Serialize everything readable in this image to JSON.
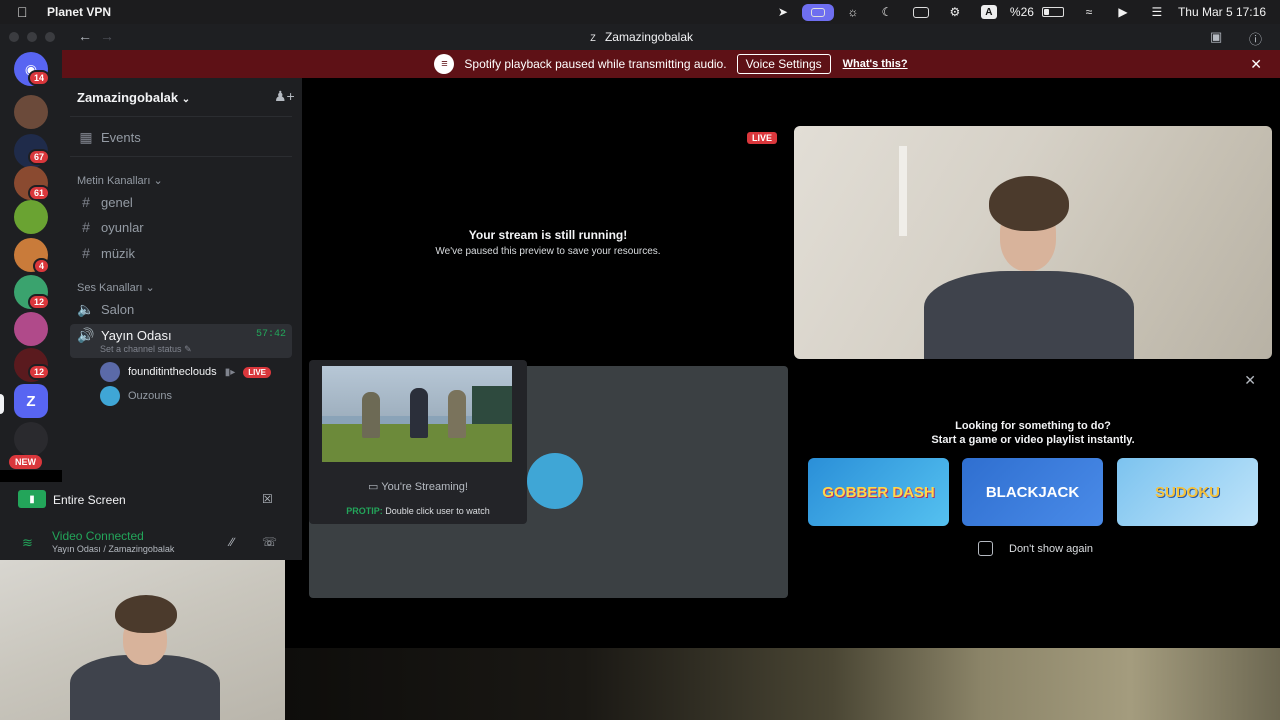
{
  "menubar": {
    "app_name": "Planet VPN",
    "battery_text": "%26",
    "battery_level": 0.26,
    "datetime": "Thu Mar 5  17:16",
    "keyboard_layout": "A",
    "icons": [
      "apple-icon",
      "rocket-icon",
      "screen-share-icon",
      "planet-icon",
      "moon-icon",
      "display-icon",
      "tweaks-icon",
      "input-source-icon",
      "battery-icon",
      "wifi-icon",
      "play-icon",
      "control-center-icon"
    ]
  },
  "window": {
    "title_initial": "Z",
    "title": "Zamazingobalak"
  },
  "banner": {
    "message": "Spotify playback paused while transmitting audio.",
    "voice_settings": "Voice Settings",
    "whats_this": "What's this?"
  },
  "rail": {
    "badges": [
      "14",
      "67",
      "61",
      "4",
      "12",
      "12"
    ],
    "new_label": "NEW",
    "server_z": "Z"
  },
  "sidebar": {
    "server_name": "Zamazingobalak",
    "events": "Events",
    "text_category": "Metin Kanalları",
    "text_channels": [
      "genel",
      "oyunlar",
      "müzik"
    ],
    "voice_category": "Ses Kanalları",
    "voice_channels": [
      "Salon",
      "Yayın Odası"
    ],
    "active_timer": "57:42",
    "status_prompt": "Set a channel status",
    "users": [
      {
        "name": "founditintheclouds",
        "live": "LIVE"
      },
      {
        "name": "Ouzouns"
      }
    ]
  },
  "share_panel": {
    "title": "Entire Screen",
    "connection": "Video Connected",
    "location": "Yayın Odası / Zamazingobalak"
  },
  "stage": {
    "live": "LIVE",
    "paused_title": "Your stream is still running!",
    "paused_sub": "We've paused this preview to save your resources.",
    "streaming_label": "You're Streaming!",
    "protip_label": "PROTIP:",
    "protip_text": "Double click user to watch",
    "activity_line1": "Looking for something to do?",
    "activity_line2": "Start a game or video playlist instantly.",
    "games": [
      "GOBBER DASH",
      "BLACKJACK",
      "SUDOKU"
    ],
    "dont_show": "Don't show again"
  },
  "colors": {
    "accent": "#5865f2",
    "green": "#23a55a",
    "red": "#da373c",
    "banner": "#5e1116",
    "background": "#000000"
  }
}
